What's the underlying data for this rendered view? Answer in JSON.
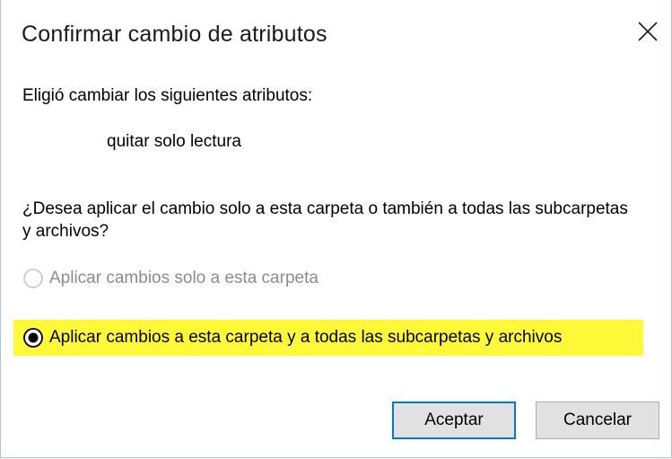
{
  "dialog": {
    "title": "Confirmar cambio de atributos",
    "close_icon": "close-icon"
  },
  "content": {
    "intro": "Eligió cambiar los siguientes atributos:",
    "attribute": "quitar solo lectura",
    "question": "¿Desea aplicar el cambio solo a esta carpeta o también a todas las subcarpetas y archivos?",
    "options": [
      {
        "label": "Aplicar cambios solo a esta carpeta",
        "selected": false,
        "enabled": false
      },
      {
        "label": "Aplicar cambios a esta carpeta y a todas las subcarpetas y archivos",
        "selected": true,
        "enabled": true
      }
    ],
    "highlight_color": "#fff93a"
  },
  "buttons": {
    "accept": "Aceptar",
    "cancel": "Cancelar"
  },
  "colors": {
    "accent": "#0078d7",
    "disabled_text": "#8c8c8c",
    "button_bg": "#e1e1e1"
  }
}
